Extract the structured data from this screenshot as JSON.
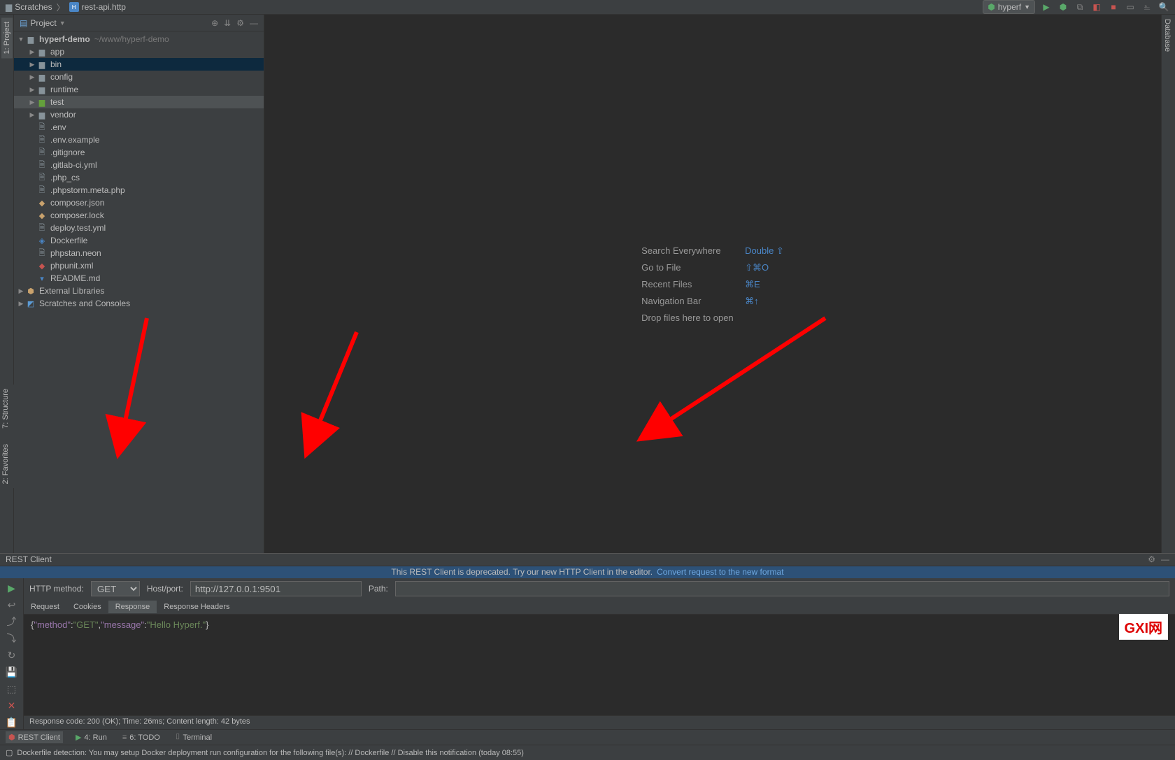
{
  "breadcrumb": {
    "folder": "Scratches",
    "file": "rest-api.http"
  },
  "topbar": {
    "runConfig": "hyperf"
  },
  "projectPanel": {
    "title": "Project",
    "root": {
      "name": "hyperf-demo",
      "path": "~/www/hyperf-demo"
    },
    "folders": [
      "app",
      "bin",
      "config",
      "runtime",
      "test",
      "vendor"
    ],
    "files": [
      ".env",
      ".env.example",
      ".gitignore",
      ".gitlab-ci.yml",
      ".php_cs",
      ".phpstorm.meta.php",
      "composer.json",
      "composer.lock",
      "deploy.test.yml",
      "Dockerfile",
      "phpstan.neon",
      "phpunit.xml",
      "README.md"
    ],
    "externalLibraries": "External Libraries",
    "scratches": "Scratches and Consoles"
  },
  "leftTabs": {
    "project": "1: Project",
    "structure": "7: Structure",
    "favorites": "2: Favorites"
  },
  "rightTabs": {
    "database": "Database"
  },
  "editor": {
    "shortcuts": [
      {
        "label": "Search Everywhere",
        "key": "Double ⇧"
      },
      {
        "label": "Go to File",
        "key": "⇧⌘O"
      },
      {
        "label": "Recent Files",
        "key": "⌘E"
      },
      {
        "label": "Navigation Bar",
        "key": "⌘↑"
      },
      {
        "label": "Drop files here to open",
        "key": ""
      }
    ]
  },
  "restClient": {
    "title": "REST Client",
    "deprecatedMsg": "This REST Client is deprecated. Try our new HTTP Client in the editor.",
    "convertLink": "Convert request to the new format",
    "methodLabel": "HTTP method:",
    "method": "GET",
    "hostLabel": "Host/port:",
    "host": "http://127.0.0.1:9501",
    "pathLabel": "Path:",
    "path": "",
    "tabs": [
      "Request",
      "Cookies",
      "Response",
      "Response Headers"
    ],
    "response": "{\"method\":\"GET\",\"message\":\"Hello Hyperf.\"}",
    "responseParts": {
      "k1": "\"method\"",
      "v1": "\"GET\"",
      "k2": "\"message\"",
      "v2": "\"Hello Hyperf.\""
    },
    "statusLine": "Response code: 200 (OK); Time: 26ms; Content length: 42 bytes"
  },
  "bottomBar": {
    "restClient": "REST Client",
    "run": "4: Run",
    "todo": "6: TODO",
    "terminal": "Terminal"
  },
  "statusBar": {
    "msg": "Dockerfile detection: You may setup Docker deployment run configuration for the following file(s): // Dockerfile // Disable this notification (today 08:55)"
  },
  "watermark": "GXI网"
}
